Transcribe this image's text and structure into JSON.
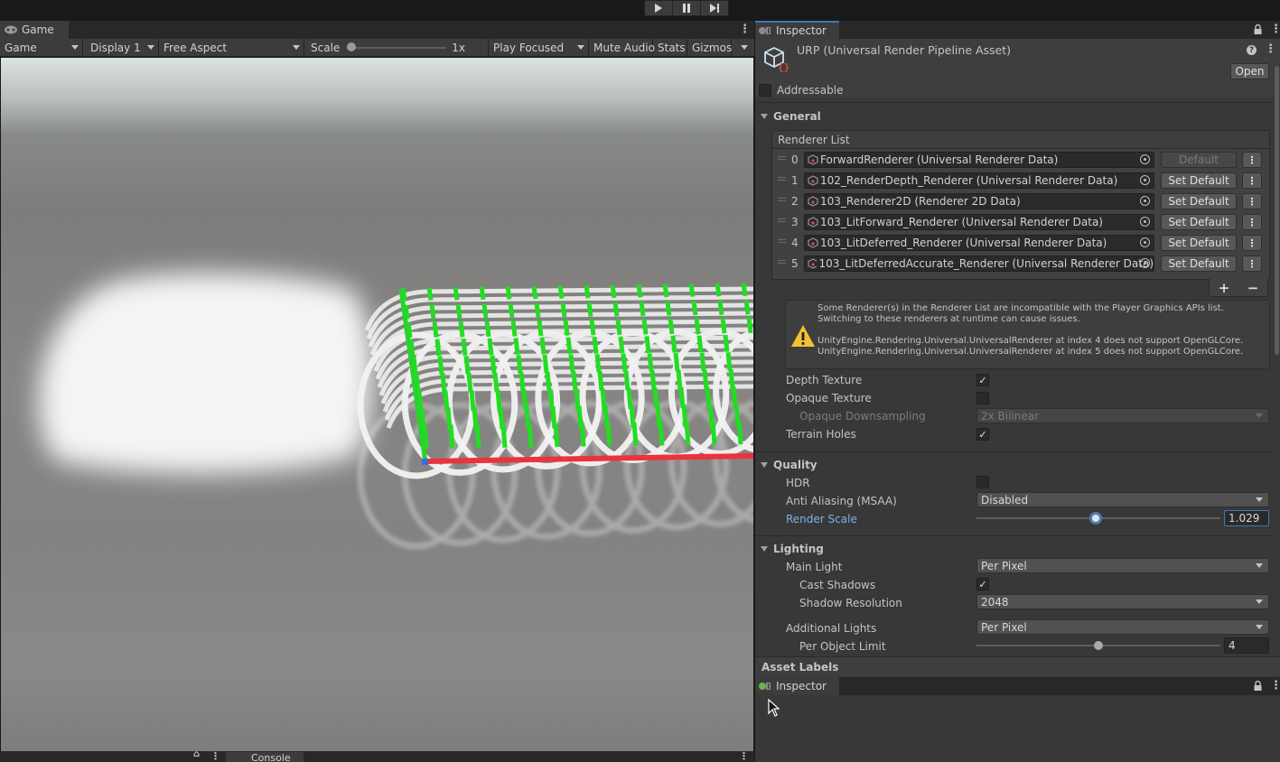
{
  "toolbar": {
    "play_icon": "play-icon",
    "pause_icon": "pause-icon",
    "step_icon": "step-icon"
  },
  "game": {
    "tab_label": "Game",
    "toolbar": {
      "view_mode": "Game",
      "display": "Display 1",
      "aspect": "Free Aspect",
      "scale_label": "Scale",
      "scale_value": "1x",
      "play_mode": "Play Focused",
      "mute": "Mute Audio",
      "stats": "Stats",
      "gizmos": "Gizmos"
    },
    "bottom_tab": "Console"
  },
  "inspector": {
    "tab_label": "Inspector",
    "asset_title": "URP (Universal Render Pipeline Asset)",
    "open_button": "Open",
    "addressable_label": "Addressable",
    "addressable_checked": false,
    "general": {
      "header": "General",
      "renderer_list_header": "Renderer List",
      "renderers": [
        {
          "index": "0",
          "name": "ForwardRenderer (Universal Renderer Data)",
          "button": "Default",
          "is_default": true
        },
        {
          "index": "1",
          "name": "102_RenderDepth_Renderer (Universal Renderer Data)",
          "button": "Set Default",
          "is_default": false
        },
        {
          "index": "2",
          "name": "103_Renderer2D (Renderer 2D Data)",
          "button": "Set Default",
          "is_default": false
        },
        {
          "index": "3",
          "name": "103_LitForward_Renderer (Universal Renderer Data)",
          "button": "Set Default",
          "is_default": false
        },
        {
          "index": "4",
          "name": "103_LitDeferred_Renderer (Universal Renderer Data)",
          "button": "Set Default",
          "is_default": false
        },
        {
          "index": "5",
          "name": "103_LitDeferredAccurate_Renderer (Universal Renderer Data)",
          "button": "Set Default",
          "is_default": false
        }
      ],
      "add_label": "+",
      "remove_label": "−",
      "warning_lines": [
        "Some Renderer(s) in the Renderer List are incompatible with the Player Graphics APIs list.  Switching to these renderers at runtime can cause issues.",
        "UnityEngine.Rendering.Universal.UniversalRenderer at index 4 does not support OpenGLCore. UnityEngine.Rendering.Universal.UniversalRenderer at index 5 does not support OpenGLCore."
      ],
      "depth_texture": {
        "label": "Depth Texture",
        "checked": true
      },
      "opaque_texture": {
        "label": "Opaque Texture",
        "checked": false
      },
      "opaque_downsampling": {
        "label": "Opaque Downsampling",
        "value": "2x Bilinear"
      },
      "terrain_holes": {
        "label": "Terrain Holes",
        "checked": true
      }
    },
    "quality": {
      "header": "Quality",
      "hdr": {
        "label": "HDR",
        "checked": false
      },
      "msaa": {
        "label": "Anti Aliasing (MSAA)",
        "value": "Disabled"
      },
      "render_scale": {
        "label": "Render Scale",
        "value": "1.029",
        "fraction": 0.49
      }
    },
    "lighting": {
      "header": "Lighting",
      "main_light": {
        "label": "Main Light",
        "value": "Per Pixel"
      },
      "cast_shadows": {
        "label": "Cast Shadows",
        "checked": true
      },
      "shadow_resolution": {
        "label": "Shadow Resolution",
        "value": "2048"
      },
      "additional_lights": {
        "label": "Additional Lights",
        "value": "Per Pixel"
      },
      "per_object_limit": {
        "label": "Per Object Limit",
        "value": "4",
        "fraction": 0.5
      }
    },
    "asset_labels": "Asset Labels",
    "second_tab_label": "Inspector"
  },
  "colors": {
    "accent": "#3a79bb",
    "gizmo_green": "#2ad62a",
    "gizmo_red": "#e83030",
    "warning": "#f2c230"
  }
}
